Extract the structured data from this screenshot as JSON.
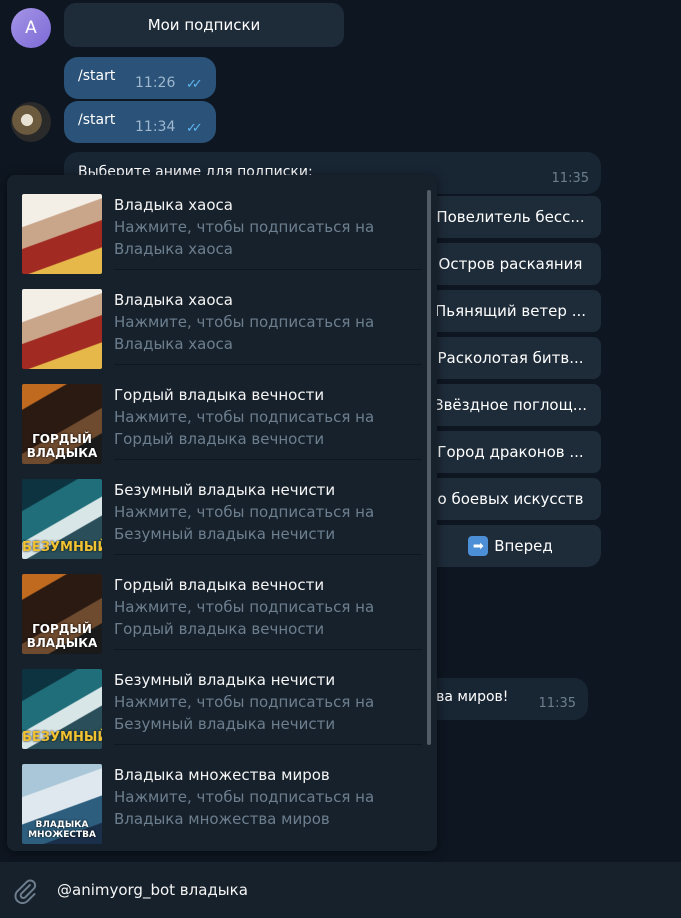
{
  "chat": {
    "my_subscriptions_button": "Мои подписки",
    "user_avatar_letter": "A",
    "outgoing": [
      {
        "text": "/start",
        "time": "11:26"
      },
      {
        "text": "/start",
        "time": "11:34"
      }
    ],
    "bot_message": {
      "text": "Выберите аниме для подписки:",
      "time": "11:35"
    },
    "keyboard": [
      "Повелитель бесс...",
      "Остров раскаяния",
      "Пьянящий ветер ...",
      "Расколотая битв...",
      "Звёздное поглощ...",
      "Город драконов ...",
      "о боевых искусств",
      "Вперед"
    ],
    "bot_message_2": {
      "text": "тва миров!",
      "time": "11:35"
    }
  },
  "inline_results": [
    {
      "title": "Владыка хаоса",
      "desc1": "Нажмите, чтобы подписаться на",
      "desc2": "Владыка хаоса",
      "caption": ""
    },
    {
      "title": "Владыка хаоса",
      "desc1": "Нажмите, чтобы подписаться на",
      "desc2": "Владыка хаоса",
      "caption": ""
    },
    {
      "title": "Гордый владыка вечности",
      "desc1": "Нажмите, чтобы подписаться на",
      "desc2": "Гордый владыка вечности",
      "caption": "ГОРДЫЙ ВЛАДЫКА"
    },
    {
      "title": "Безумный владыка нечисти",
      "desc1": "Нажмите, чтобы подписаться на",
      "desc2": "Безумный владыка нечисти",
      "caption": "БЕЗУМНЫЙ"
    },
    {
      "title": "Гордый владыка вечности",
      "desc1": "Нажмите, чтобы подписаться на",
      "desc2": "Гордый владыка вечности",
      "caption": "ГОРДЫЙ ВЛАДЫКА"
    },
    {
      "title": "Безумный владыка нечисти",
      "desc1": "Нажмите, чтобы подписаться на",
      "desc2": "Безумный владыка нечисти",
      "caption": "БЕЗУМНЫЙ"
    },
    {
      "title": "Владыка множества миров",
      "desc1": "Нажмите, чтобы подписаться на",
      "desc2": "Владыка множества миров",
      "caption": "ВЛАДЫКА МНОЖЕСТВА"
    }
  ],
  "composer": {
    "value": "@animyorg_bot владыка",
    "attach_icon": "paperclip-icon"
  },
  "colors": {
    "background": "#0e1621",
    "outgoing_bubble": "#2b5278",
    "incoming_bubble": "#182533",
    "read_ticks": "#5fb6ef"
  }
}
